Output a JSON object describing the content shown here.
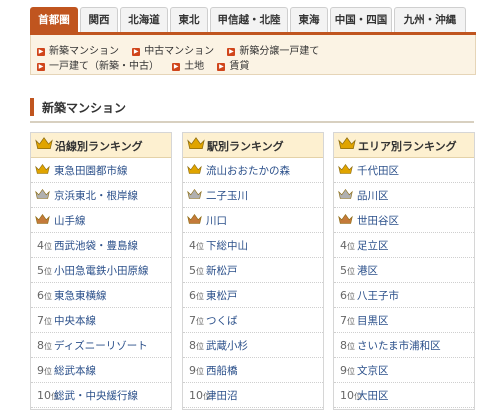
{
  "tabs": [
    {
      "label": "首都圏",
      "active": true
    },
    {
      "label": "関西"
    },
    {
      "label": "北海道"
    },
    {
      "label": "東北"
    },
    {
      "label": "甲信越・北陸"
    },
    {
      "label": "東海"
    },
    {
      "label": "中国・四国"
    },
    {
      "label": "九州・沖縄"
    }
  ],
  "links": {
    "row1": [
      "新築マンション",
      "中古マンション",
      "新築分譲一戸建て"
    ],
    "row2": [
      "一戸建て（新築・中古）",
      "土地",
      "賃貸"
    ]
  },
  "section_title": "新築マンション",
  "rankings": [
    {
      "title": "沿線別ランキング",
      "items": [
        "東急田園都市線",
        "京浜東北・根岸線",
        "山手線",
        "西武池袋・豊島線",
        "小田急電鉄小田原線",
        "東急東横線",
        "中央本線",
        "ディズニーリゾート",
        "総武本線",
        "総武・中央緩行線"
      ]
    },
    {
      "title": "駅別ランキング",
      "items": [
        "流山おおたかの森",
        "二子玉川",
        "川口",
        "下総中山",
        "新松戸",
        "東松戸",
        "つくば",
        "武蔵小杉",
        "西船橋",
        "津田沼"
      ]
    },
    {
      "title": "エリア別ランキング",
      "items": [
        "千代田区",
        "品川区",
        "世田谷区",
        "足立区",
        "港区",
        "八王子市",
        "目黒区",
        "さいたま市浦和区",
        "文京区",
        "大田区"
      ]
    }
  ],
  "rank_labels": [
    "1",
    "2",
    "3",
    "4",
    "5",
    "6",
    "7",
    "8",
    "9",
    "10"
  ],
  "rank_suffix": "位",
  "colors": {
    "accent": "#c0551f",
    "link": "#2a4f8a",
    "gold": "#e0a400",
    "silver": "#b0b0b0",
    "bronze": "#c47a3a"
  },
  "icons": {
    "crown": "crown-icon",
    "arrow": "arrow-right-icon"
  }
}
